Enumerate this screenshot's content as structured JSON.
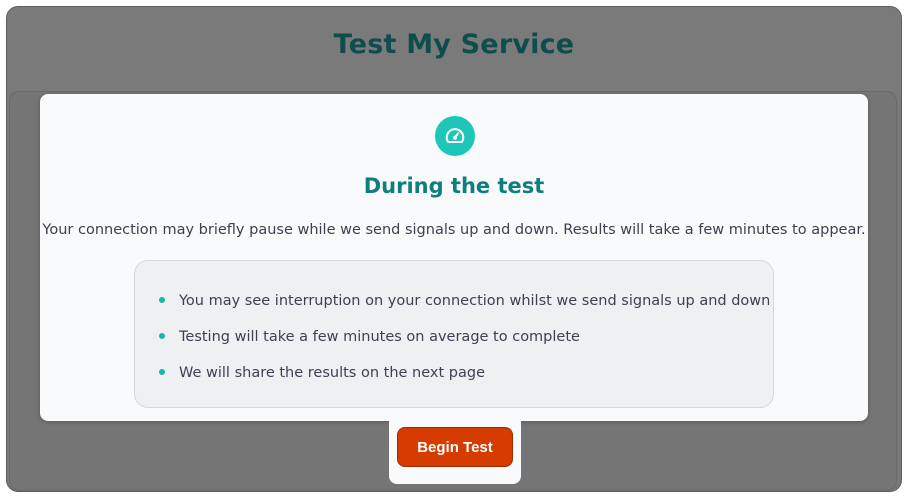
{
  "page": {
    "title": "Test My Service"
  },
  "modal": {
    "icon": "speedometer-icon",
    "heading": "During the test",
    "description": "Your connection may briefly pause while we send signals up and down. Results will take a few minutes to appear.",
    "bullets": [
      "You may see interruption on your connection whilst we send signals up and down",
      "Testing will take a few minutes on average to complete",
      "We will share the results on the next page"
    ]
  },
  "actions": {
    "begin_label": "Begin Test"
  },
  "colors": {
    "overlay": "#7a7a7a",
    "title": "#0f4d4d",
    "heading": "#0e7f7f",
    "accent": "#1ec6b9",
    "button": "#d63c00"
  }
}
